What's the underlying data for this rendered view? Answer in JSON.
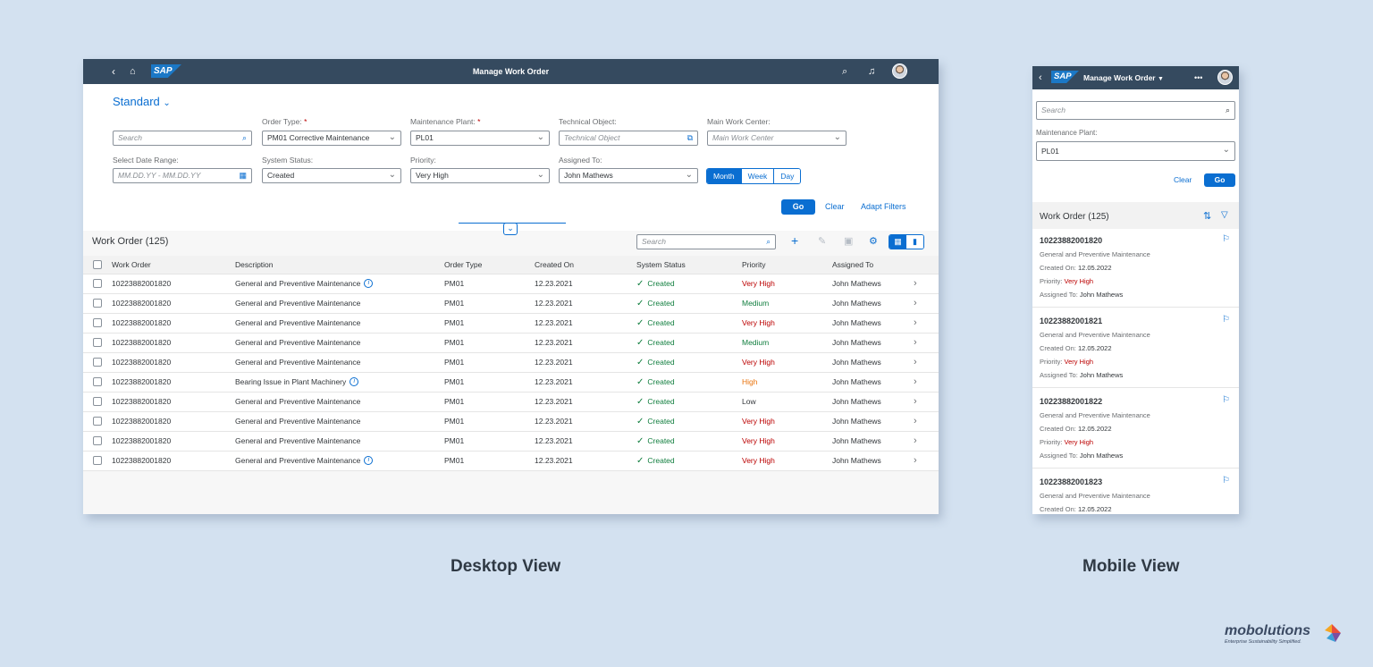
{
  "colors": {
    "shell": "#354a5f",
    "accent": "#0a6ed1",
    "positive": "#107e3e",
    "critical": "#bb0000",
    "warning": "#e9730c",
    "background": "#d3e1f0"
  },
  "desktop": {
    "shell": {
      "title": "Manage Work Order",
      "logo": "SAP",
      "icons": [
        "back-icon",
        "home-icon",
        "search-icon",
        "bell-icon",
        "avatar"
      ]
    },
    "filterbar": {
      "variant": "Standard",
      "search_placeholder": "Search",
      "order_type": {
        "label": "Order Type:",
        "required": "*",
        "value": "PM01 Corrective Maintenance"
      },
      "maintenance_plant": {
        "label": "Maintenance Plant:",
        "required": "*",
        "value": "PL01"
      },
      "technical_object": {
        "label": "Technical Object:",
        "placeholder": "Technical Object"
      },
      "main_work_center": {
        "label": "Main Work Center:",
        "placeholder": "Main Work Center"
      },
      "date_range": {
        "label": "Select Date Range:",
        "placeholder": "MM.DD.YY - MM.DD.YY"
      },
      "system_status": {
        "label": "System Status:",
        "value": "Created"
      },
      "priority": {
        "label": "Priority:",
        "value": "Very High"
      },
      "assigned_to": {
        "label": "Assigned To:",
        "value": "John Mathews"
      },
      "segments": [
        "Month",
        "Week",
        "Day"
      ],
      "selected_segment": "Month",
      "go": "Go",
      "clear": "Clear",
      "adapt_filters": "Adapt Filters"
    },
    "table": {
      "title": "Work Order (125)",
      "search_placeholder": "Search",
      "columns": [
        "Work Order",
        "Description",
        "Order Type",
        "Created On",
        "System Status",
        "Priority",
        "Assigned To"
      ],
      "rows": [
        {
          "order": "10223882001820",
          "desc": "General and Preventive Maintenance",
          "info": true,
          "type": "PM01",
          "created": "12.23.2021",
          "status": "Created",
          "priority": "Very High",
          "priority_color": "#bb0000",
          "assigned": "John Mathews"
        },
        {
          "order": "10223882001820",
          "desc": "General and Preventive Maintenance",
          "info": false,
          "type": "PM01",
          "created": "12.23.2021",
          "status": "Created",
          "priority": "Medium",
          "priority_color": "#107e3e",
          "assigned": "John Mathews"
        },
        {
          "order": "10223882001820",
          "desc": "General and Preventive Maintenance",
          "info": false,
          "type": "PM01",
          "created": "12.23.2021",
          "status": "Created",
          "priority": "Very High",
          "priority_color": "#bb0000",
          "assigned": "John Mathews"
        },
        {
          "order": "10223882001820",
          "desc": "General and Preventive Maintenance",
          "info": false,
          "type": "PM01",
          "created": "12.23.2021",
          "status": "Created",
          "priority": "Medium",
          "priority_color": "#107e3e",
          "assigned": "John Mathews"
        },
        {
          "order": "10223882001820",
          "desc": "General and Preventive Maintenance",
          "info": false,
          "type": "PM01",
          "created": "12.23.2021",
          "status": "Created",
          "priority": "Very High",
          "priority_color": "#bb0000",
          "assigned": "John Mathews"
        },
        {
          "order": "10223882001820",
          "desc": "Bearing Issue in Plant Machinery",
          "info": true,
          "type": "PM01",
          "created": "12.23.2021",
          "status": "Created",
          "priority": "High",
          "priority_color": "#e9730c",
          "assigned": "John Mathews"
        },
        {
          "order": "10223882001820",
          "desc": "General and Preventive Maintenance",
          "info": false,
          "type": "PM01",
          "created": "12.23.2021",
          "status": "Created",
          "priority": "Low",
          "priority_color": "#32363a",
          "assigned": "John Mathews"
        },
        {
          "order": "10223882001820",
          "desc": "General and Preventive Maintenance",
          "info": false,
          "type": "PM01",
          "created": "12.23.2021",
          "status": "Created",
          "priority": "Very High",
          "priority_color": "#bb0000",
          "assigned": "John Mathews"
        },
        {
          "order": "10223882001820",
          "desc": "General and Preventive Maintenance",
          "info": false,
          "type": "PM01",
          "created": "12.23.2021",
          "status": "Created",
          "priority": "Very High",
          "priority_color": "#bb0000",
          "assigned": "John Mathews"
        },
        {
          "order": "10223882001820",
          "desc": "General and Preventive Maintenance",
          "info": true,
          "type": "PM01",
          "created": "12.23.2021",
          "status": "Created",
          "priority": "Very High",
          "priority_color": "#bb0000",
          "assigned": "John Mathews"
        }
      ]
    }
  },
  "mobile": {
    "shell": {
      "title": "Manage Work Order",
      "logo": "SAP"
    },
    "search_placeholder": "Search",
    "maintenance_plant": {
      "label": "Maintenance Plant:",
      "value": "PL01"
    },
    "clear": "Clear",
    "go": "Go",
    "list_title": "Work Order (125)",
    "items": [
      {
        "id": "10223882001820",
        "desc": "General and Preventive Maintenance",
        "created_label": "Created On:",
        "created": "12.05.2022",
        "priority_label": "Priority:",
        "priority": "Very High",
        "assigned_label": "Assigned To:",
        "assigned": "John Mathews"
      },
      {
        "id": "10223882001821",
        "desc": "General and Preventive Maintenance",
        "created_label": "Created On:",
        "created": "12.05.2022",
        "priority_label": "Priority:",
        "priority": "Very High",
        "assigned_label": "Assigned To:",
        "assigned": "John Mathews"
      },
      {
        "id": "10223882001822",
        "desc": "General and Preventive Maintenance",
        "created_label": "Created On:",
        "created": "12.05.2022",
        "priority_label": "Priority:",
        "priority": "Very High",
        "assigned_label": "Assigned To:",
        "assigned": "John Mathews"
      },
      {
        "id": "10223882001823",
        "desc": "General and Preventive Maintenance",
        "created_label": "Created On:",
        "created": "12.05.2022"
      }
    ]
  },
  "captions": {
    "desktop": "Desktop View",
    "mobile": "Mobile View"
  },
  "brand": {
    "name": "mobolutions",
    "tagline": "Enterprise Sustainability Simplified."
  }
}
